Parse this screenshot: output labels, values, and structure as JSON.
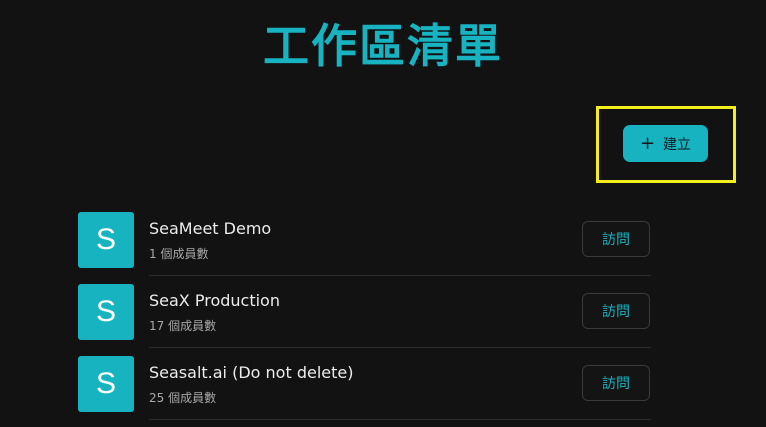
{
  "header": {
    "title": "工作區清單"
  },
  "actions": {
    "create_label": "建立",
    "create_icon": "plus-icon"
  },
  "workspaces": [
    {
      "avatar": "S",
      "name": "SeaMeet Demo",
      "members": "1 個成員數",
      "visit_label": "訪問"
    },
    {
      "avatar": "S",
      "name": "SeaX Production",
      "members": "17 個成員數",
      "visit_label": "訪問"
    },
    {
      "avatar": "S",
      "name": "Seasalt.ai (Do not delete)",
      "members": "25 個成員數",
      "visit_label": "訪問"
    }
  ],
  "colors": {
    "accent": "#17b3c1",
    "background": "#121212",
    "highlight": "#f2ef1c"
  }
}
